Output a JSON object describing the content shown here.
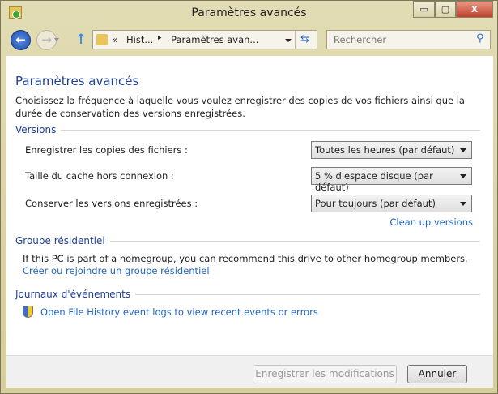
{
  "window": {
    "title": "Paramètres avancés",
    "minimize": "▭",
    "maximize": "▢",
    "close": "X"
  },
  "nav": {
    "breadcrumb_prefix": "«",
    "crumb1": "Hist...",
    "separator": "▸",
    "crumb2": "Paramètres avan...",
    "search_placeholder": "Rechercher"
  },
  "main": {
    "heading": "Paramètres avancés",
    "description": "Choisissez la fréquence à laquelle vous voulez enregistrer des copies de vos fichiers ainsi que la durée de conservation des versions enregistrées.",
    "versions": {
      "title": "Versions",
      "rows": [
        {
          "label": "Enregistrer les copies des fichiers :",
          "value": "Toutes les heures (par défaut)"
        },
        {
          "label": "Taille du cache hors connexion :",
          "value": "5 % d'espace disque (par défaut)"
        },
        {
          "label": "Conserver les versions enregistrées :",
          "value": "Pour toujours (par défaut)"
        }
      ],
      "cleanup_link": "Clean up versions"
    },
    "homegroup": {
      "title": "Groupe résidentiel",
      "text": "If this PC is part of a homegroup, you can recommend this drive to other homegroup members.",
      "link": "Créer ou rejoindre un groupe résidentiel"
    },
    "events": {
      "title": "Journaux d'événements",
      "link": "Open File History event logs to view recent events or errors"
    }
  },
  "footer": {
    "save": "Enregistrer les modifications",
    "cancel": "Annuler"
  }
}
